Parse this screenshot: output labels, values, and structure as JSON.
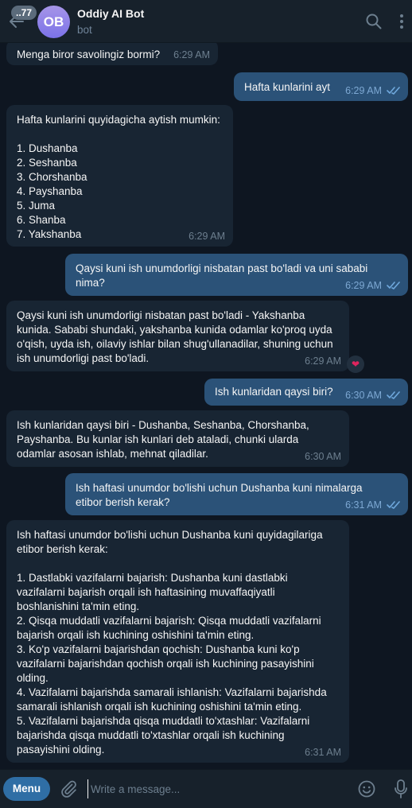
{
  "header": {
    "unread_count": "..77",
    "avatar_initials": "OB",
    "title": "Oddiy AI Bot",
    "subtitle": "bot"
  },
  "messages": [
    {
      "dir": "in",
      "text": "Menga biror savolingiz bormi?",
      "time": "6:29 AM"
    },
    {
      "dir": "out",
      "text": "Hafta kunlarini ayt",
      "time": "6:29 AM",
      "read": true
    },
    {
      "dir": "in",
      "text": "Hafta kunlarini quyidagicha aytish mumkin:\n\n1. Dushanba\n2. Seshanba\n3. Chorshanba\n4. Payshanba\n5. Juma\n6. Shanba\n7. Yakshanba",
      "time": "6:29 AM"
    },
    {
      "dir": "out",
      "text": "Qaysi kuni ish unumdorligi nisbatan past bo'ladi va uni sababi\nnima?",
      "time": "6:29 AM",
      "read": true
    },
    {
      "dir": "in",
      "text": "Qaysi kuni ish unumdorligi nisbatan past bo'ladi - Yakshanba\nkunida. Sababi shundaki, yakshanba kunida odamlar ko'proq uyda\no'qish, uyda ish, oilaviy ishlar bilan shug'ullanadilar, shuning uchun\nish unumdorligi past bo'ladi.",
      "time": "6:29 AM",
      "reaction": "heart"
    },
    {
      "dir": "out",
      "text": "Ish kunlaridan qaysi biri?",
      "time": "6:30 AM",
      "read": true
    },
    {
      "dir": "in",
      "text": "Ish kunlaridan qaysi biri - Dushanba, Seshanba, Chorshanba,\nPayshanba. Bu kunlar ish kunlari deb ataladi, chunki ularda\nodamlar asosan ishlab, mehnat qiladilar.",
      "time": "6:30 AM"
    },
    {
      "dir": "out",
      "text": "Ish haftasi unumdor bo'lishi uchun Dushanba kuni nimalarga\netibor berish kerak?",
      "time": "6:31 AM",
      "read": true
    },
    {
      "dir": "in",
      "text": "Ish haftasi unumdor bo'lishi uchun Dushanba kuni quyidagilariga\netibor berish kerak:\n\n1. Dastlabki vazifalarni bajarish: Dushanba kuni dastlabki\nvazifalarni bajarish orqali ish haftasining muvaffaqiyatli\nboshlanishini ta'min eting.\n2. Qisqa muddatli vazifalarni bajarish: Qisqa muddatli vazifalarni\nbajarish orqali ish kuchining oshishini ta'min eting.\n3. Ko'p vazifalarni bajarishdan qochish: Dushanba kuni ko'p\nvazifalarni bajarishdan qochish orqali ish kuchining pasayishini\nolding.\n4. Vazifalarni bajarishda samarali ishlanish: Vazifalarni bajarishda\nsamarali ishlanish orqali ish kuchining oshishini ta'min eting.\n5. Vazifalarni bajarishda qisqa muddatli to'xtashlar: Vazifalarni\nbajarishda qisqa muddatli to'xtashlar orqali ish kuchining\npasayishini olding.",
      "time": "6:31 AM"
    }
  ],
  "composer": {
    "menu_label": "Menu",
    "placeholder": "Write a message..."
  },
  "colors": {
    "background": "#0e1621",
    "header": "#17212b",
    "incoming_bubble": "#182533",
    "outgoing_bubble": "#2b5278",
    "accent": "#2f6ea5"
  }
}
